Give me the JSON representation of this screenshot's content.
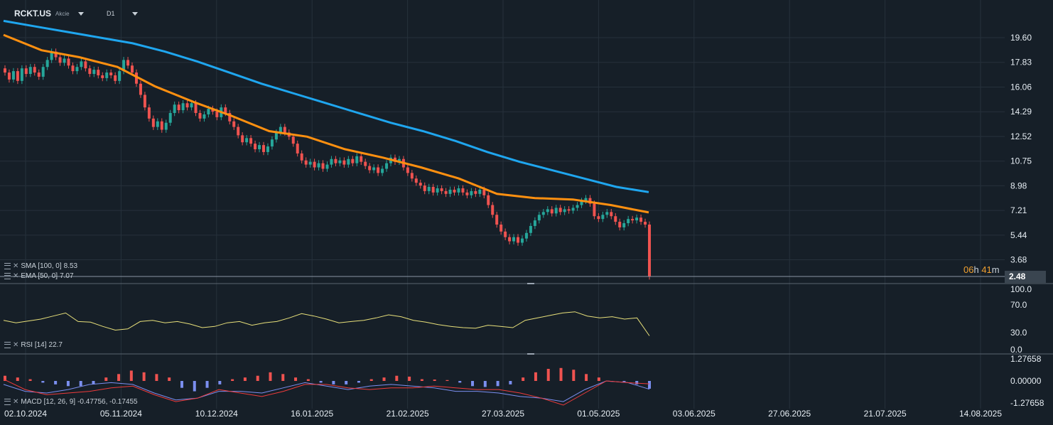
{
  "header": {
    "symbol": "RCKT.US",
    "type": "Akcie",
    "timeframe": "D1"
  },
  "colors": {
    "background": "#161f28",
    "grid": "#26313b",
    "bull": "#26a69a",
    "bear": "#ef5350",
    "sma": "#1fa6ef",
    "ema": "#ff9010",
    "rsi": "#e8e07a",
    "macd_line": "#7b8ff0",
    "macd_signal": "#ef3b3b"
  },
  "indicators": {
    "sma": {
      "label": "SMA [100, 0]",
      "value": "8.53"
    },
    "ema": {
      "label": "EMA [50, 0]",
      "value": "7.07"
    },
    "rsi": {
      "label": "RSI [14]",
      "value": "22.7"
    },
    "macd": {
      "label": "MACD [12, 26, 9]",
      "value": "-0.47756, -0.17455"
    }
  },
  "timer": {
    "hours": "06",
    "h_unit": "h",
    "minutes": "41",
    "m_unit": "m"
  },
  "last_price": "2.48",
  "chart_data": {
    "type": "candlestick",
    "x_ticks": [
      "02.10.2024",
      "05.11.2024",
      "10.12.2024",
      "16.01.2025",
      "21.02.2025",
      "27.03.2025",
      "01.05.2025",
      "03.06.2025",
      "27.06.2025",
      "21.07.2025",
      "14.08.2025"
    ],
    "price_axis": [
      "19.60",
      "17.83",
      "16.06",
      "14.29",
      "12.52",
      "10.75",
      "8.98",
      "7.21",
      "5.44",
      "3.68",
      "2.48"
    ],
    "ylim": [
      2.48,
      21.0
    ],
    "rsi_axis": [
      "100.0",
      "70.0",
      "30.0",
      "0.0"
    ],
    "macd_axis": [
      "1.27658",
      "0.00000",
      "-1.27658"
    ],
    "close": [
      17.1,
      16.6,
      17.2,
      16.5,
      17.4,
      17.0,
      17.5,
      17.1,
      16.8,
      17.5,
      18.0,
      18.6,
      18.2,
      17.8,
      18.1,
      17.6,
      17.2,
      17.5,
      17.9,
      17.4,
      17.0,
      17.3,
      16.9,
      16.7,
      17.1,
      16.9,
      16.5,
      17.2,
      18.0,
      17.6,
      17.1,
      16.3,
      15.5,
      14.6,
      13.8,
      13.2,
      13.6,
      13.0,
      13.5,
      14.2,
      14.8,
      14.4,
      14.9,
      14.6,
      14.9,
      14.2,
      13.8,
      14.1,
      14.5,
      14.3,
      13.9,
      14.6,
      14.2,
      13.6,
      13.2,
      12.6,
      12.1,
      12.4,
      12.0,
      11.6,
      11.9,
      11.4,
      11.8,
      12.3,
      12.8,
      13.2,
      12.8,
      12.5,
      12.0,
      11.3,
      10.8,
      10.5,
      10.7,
      10.3,
      10.6,
      10.2,
      10.5,
      10.9,
      10.6,
      10.8,
      10.5,
      10.9,
      10.6,
      11.1,
      10.7,
      10.4,
      10.1,
      10.3,
      9.9,
      10.2,
      10.6,
      11.0,
      10.7,
      10.9,
      10.3,
      9.9,
      9.5,
      9.2,
      9.0,
      8.6,
      8.9,
      8.5,
      8.8,
      8.6,
      8.4,
      8.7,
      8.5,
      8.8,
      8.5,
      8.3,
      8.6,
      8.4,
      8.7,
      8.3,
      7.6,
      6.9,
      6.2,
      5.7,
      5.3,
      5.0,
      5.3,
      4.9,
      5.2,
      5.6,
      6.1,
      6.5,
      6.9,
      7.1,
      7.3,
      7.0,
      7.4,
      7.1,
      7.3,
      7.2,
      7.4,
      7.6,
      7.9,
      8.1,
      7.7,
      6.8,
      6.6,
      6.9,
      7.1,
      6.8,
      6.4,
      6.0,
      6.3,
      6.6,
      6.5,
      6.7,
      6.4,
      6.2,
      2.48
    ],
    "sma": [
      20.8,
      20.4,
      20.0,
      19.6,
      19.2,
      18.6,
      17.9,
      17.1,
      16.3,
      15.6,
      14.9,
      14.2,
      13.5,
      12.9,
      12.2,
      11.4,
      10.7,
      10.1,
      9.5,
      8.9,
      8.53
    ],
    "ema": [
      19.8,
      18.7,
      18.2,
      17.5,
      16.1,
      15.0,
      14.0,
      12.9,
      12.5,
      11.6,
      11.0,
      10.3,
      9.5,
      8.4,
      8.1,
      8.0,
      7.6,
      7.07
    ],
    "rsi": [
      48,
      44,
      47,
      50,
      55,
      60,
      46,
      45,
      38,
      32,
      34,
      46,
      48,
      44,
      46,
      42,
      36,
      38,
      44,
      46,
      40,
      44,
      46,
      52,
      59,
      55,
      50,
      44,
      46,
      48,
      52,
      57,
      54,
      48,
      45,
      41,
      38,
      36,
      35,
      40,
      38,
      36,
      48,
      52,
      56,
      60,
      62,
      55,
      52,
      54,
      50,
      52,
      22.7
    ],
    "macd_hist": [
      0.3,
      0.2,
      0.1,
      -0.1,
      -0.2,
      -0.3,
      -0.3,
      -0.2,
      0.2,
      0.4,
      0.6,
      0.5,
      0.4,
      0.2,
      -0.4,
      -0.6,
      -0.4,
      -0.2,
      0.1,
      0.2,
      0.3,
      0.5,
      0.4,
      0.2,
      0.1,
      -0.1,
      -0.2,
      -0.2,
      -0.1,
      0.1,
      0.2,
      0.3,
      0.25,
      0.1,
      0.08,
      0.05,
      -0.1,
      -0.3,
      -0.35,
      -0.3,
      -0.2,
      0.2,
      0.5,
      0.7,
      0.75,
      0.65,
      0.4,
      0.2,
      -0.05,
      -0.1,
      -0.2,
      -0.45
    ],
    "macd_line": [
      -0.2,
      -0.6,
      -0.7,
      -0.5,
      -0.2,
      -0.1,
      -0.2,
      -0.7,
      -1.1,
      -1.0,
      -0.6,
      -0.6,
      -0.7,
      -0.4,
      -0.1,
      -0.3,
      -0.5,
      -0.3,
      -0.2,
      -0.3,
      -0.4,
      -0.6,
      -0.6,
      -0.7,
      -0.9,
      -1.0,
      -1.2,
      -0.5,
      0.0,
      -0.1,
      -0.48
    ],
    "macd_signal": [
      0.1,
      -0.5,
      -0.8,
      -0.7,
      -0.6,
      -0.4,
      -0.3,
      -0.8,
      -1.2,
      -1.0,
      -0.5,
      -0.7,
      -0.9,
      -0.6,
      -0.2,
      -0.2,
      -0.4,
      -0.5,
      -0.4,
      -0.4,
      -0.3,
      -0.4,
      -0.5,
      -0.5,
      -0.7,
      -1.0,
      -1.4,
      -0.7,
      0.0,
      -0.1,
      -0.17
    ]
  }
}
